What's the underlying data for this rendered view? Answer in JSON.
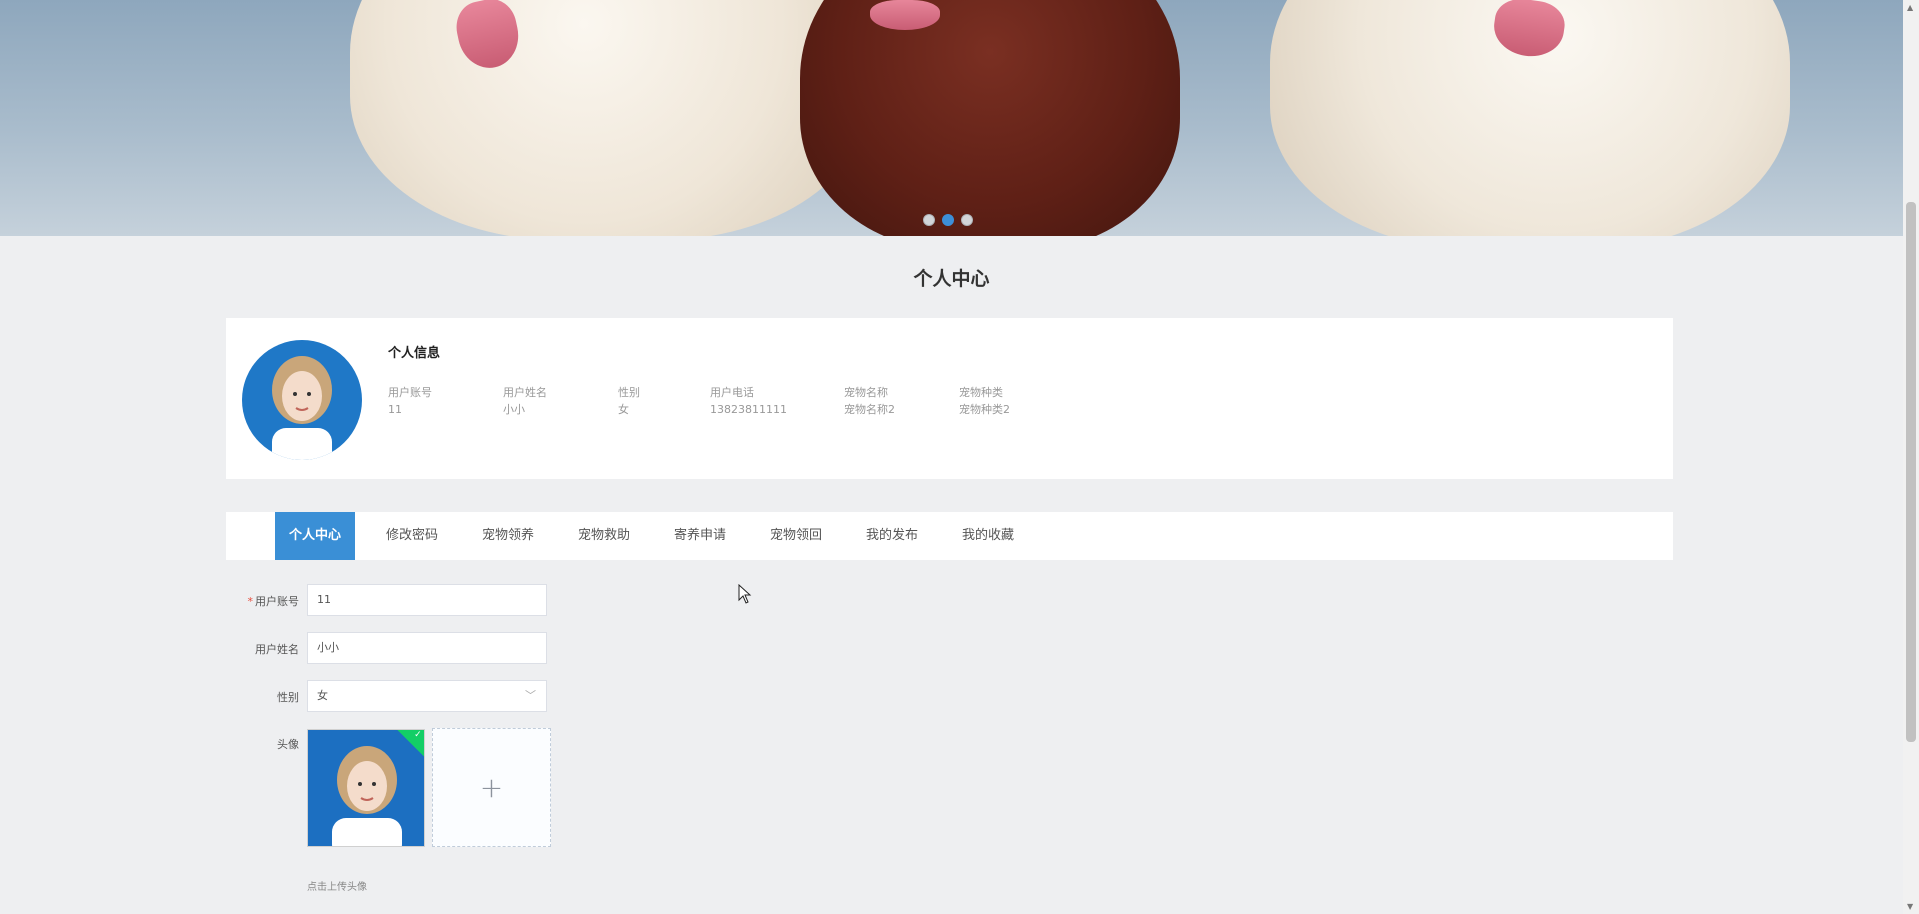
{
  "page_title": "个人中心",
  "info": {
    "title": "个人信息",
    "fields": [
      {
        "label": "用户账号",
        "value": "11"
      },
      {
        "label": "用户姓名",
        "value": "小小"
      },
      {
        "label": "性别",
        "value": "女"
      },
      {
        "label": "用户电话",
        "value": "13823811111"
      },
      {
        "label": "宠物名称",
        "value": "宠物名称2"
      },
      {
        "label": "宠物种类",
        "value": "宠物种类2"
      }
    ]
  },
  "tabs": [
    {
      "label": "个人中心",
      "active": true
    },
    {
      "label": "修改密码"
    },
    {
      "label": "宠物领养"
    },
    {
      "label": "宠物救助"
    },
    {
      "label": "寄养申请"
    },
    {
      "label": "宠物领回"
    },
    {
      "label": "我的发布"
    },
    {
      "label": "我的收藏"
    }
  ],
  "form": {
    "account": {
      "label": "用户账号",
      "value": "11",
      "required": "*"
    },
    "name": {
      "label": "用户姓名",
      "value": "小小"
    },
    "gender": {
      "label": "性别",
      "value": "女"
    },
    "avatar": {
      "label": "头像",
      "hint": "点击上传头像",
      "add_symbol": "+"
    }
  },
  "carousel": {
    "slides": 3,
    "active_index": 1
  },
  "colors": {
    "accent": "#3a8fd6",
    "success": "#13ce66",
    "required": "#e74c3c"
  }
}
